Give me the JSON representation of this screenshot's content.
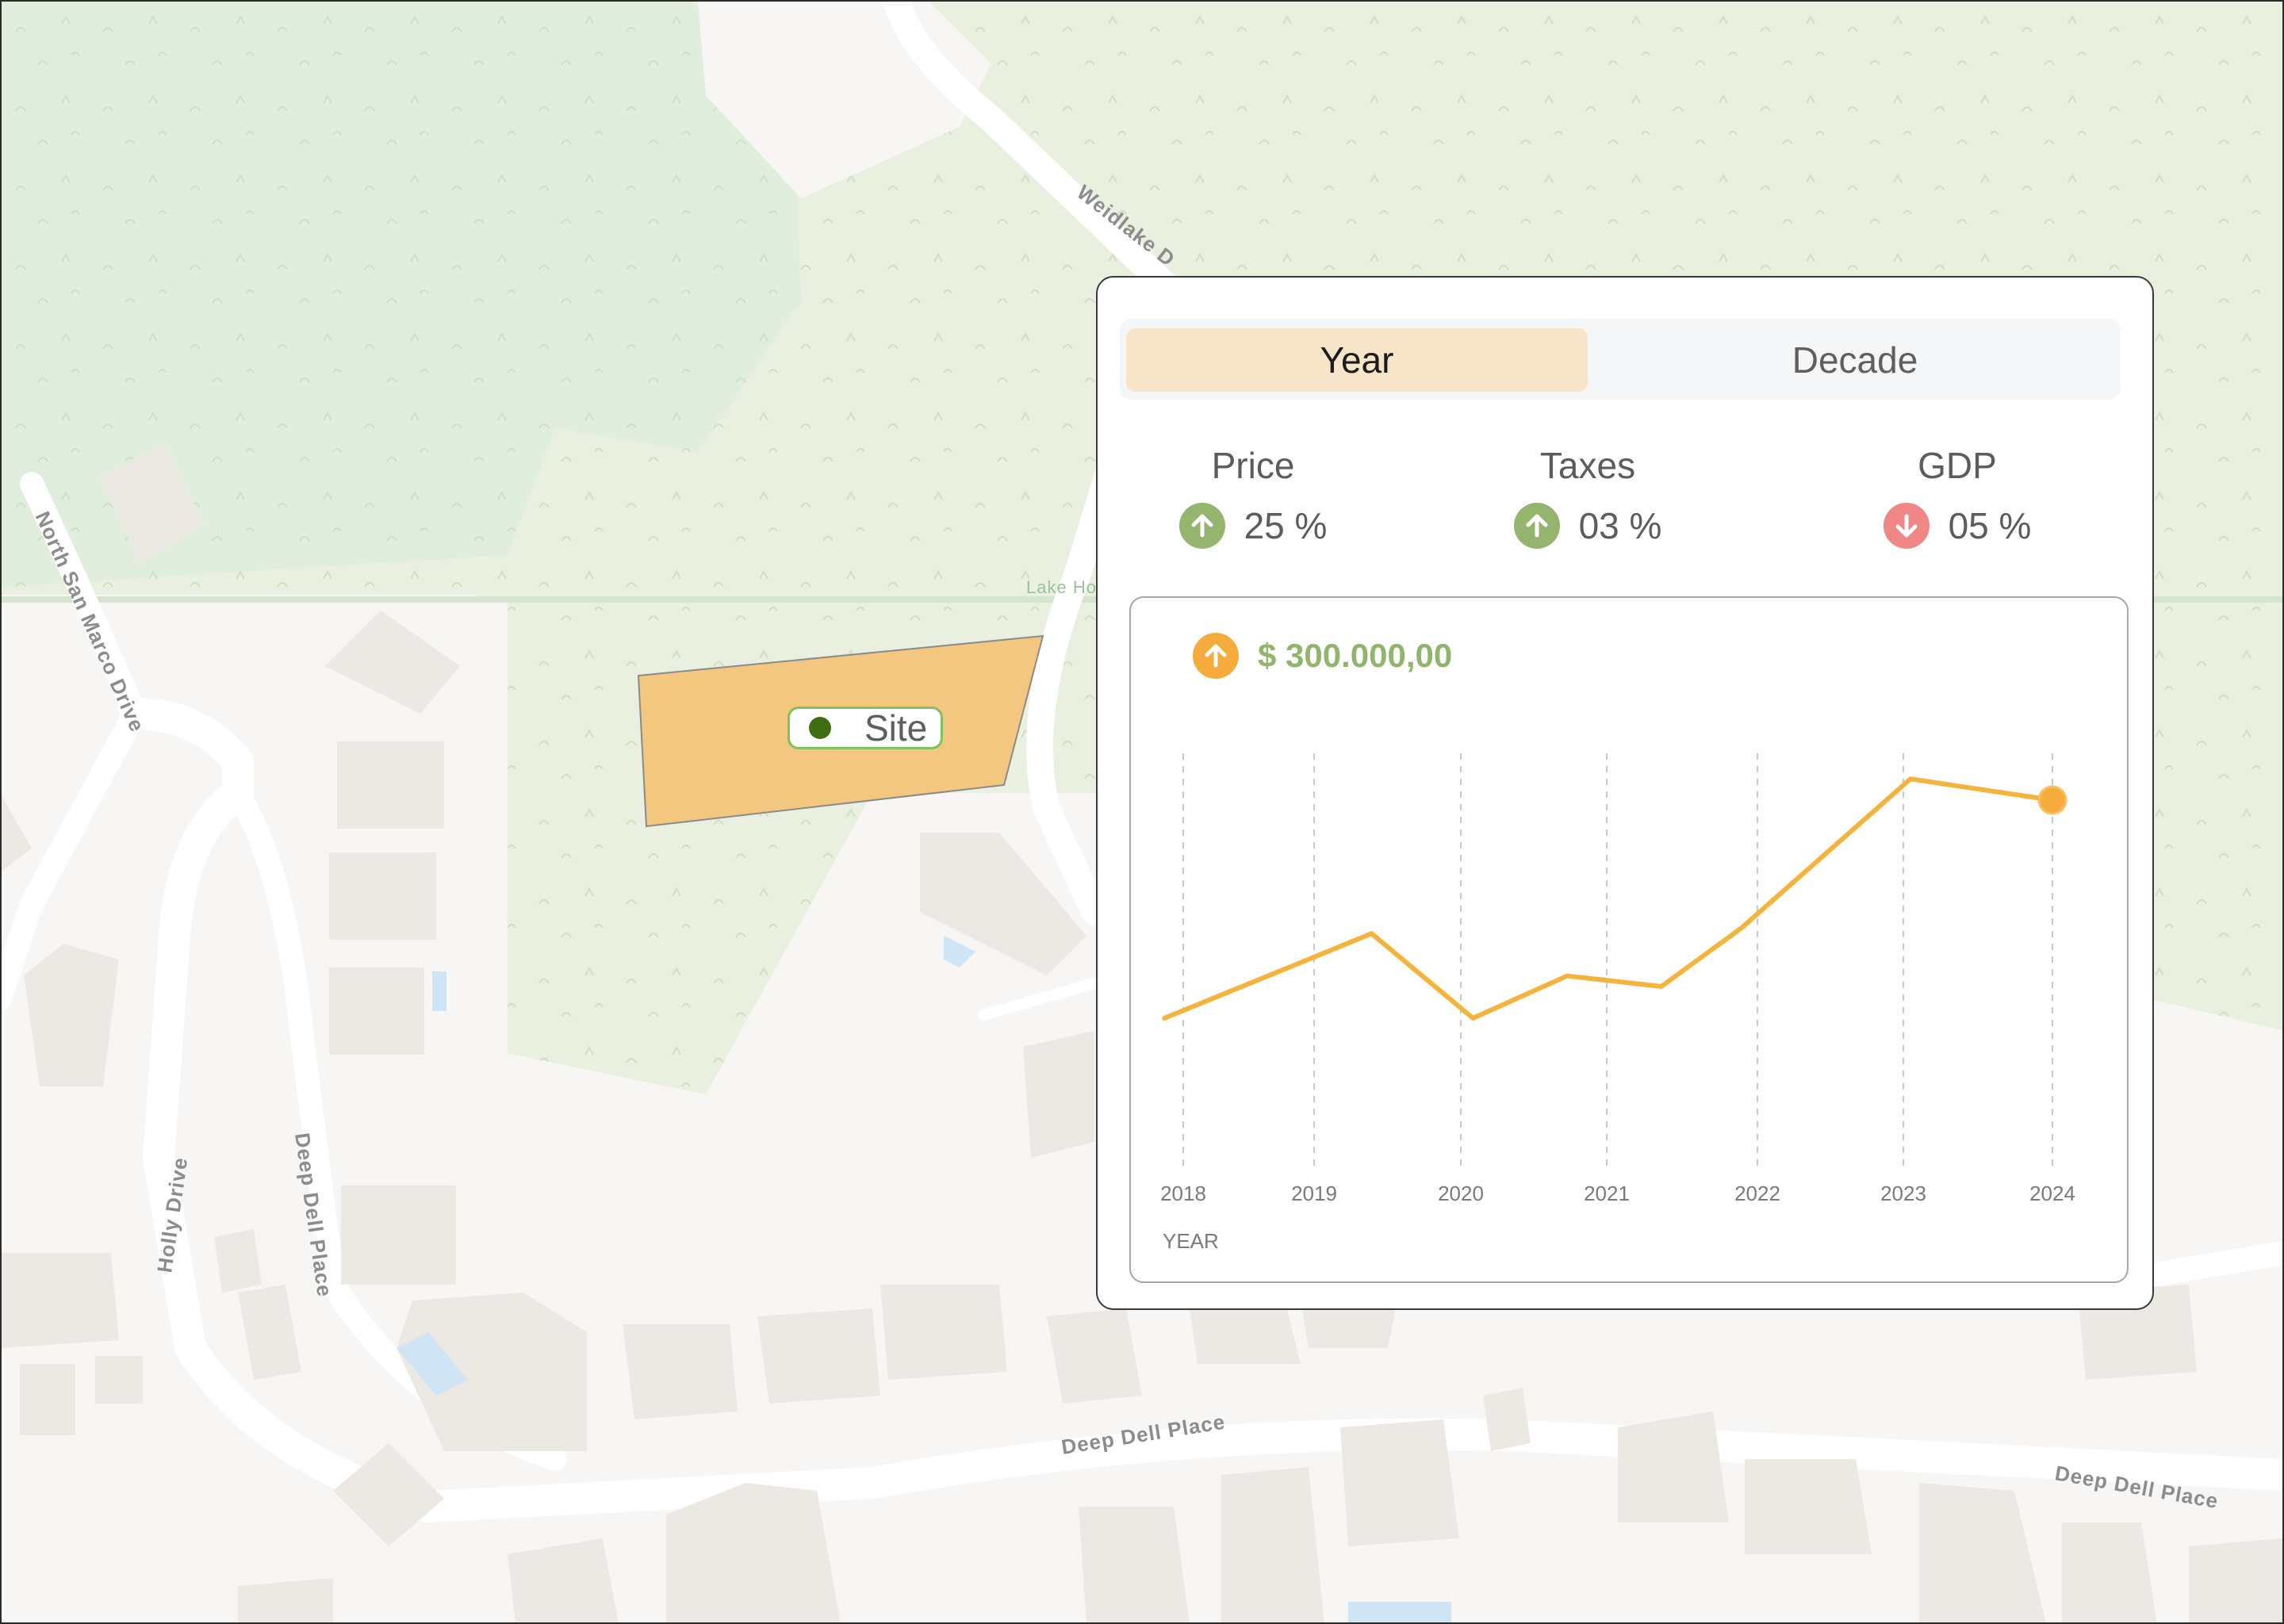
{
  "map": {
    "road_labels": [
      "Weidlake D",
      "North San Marco Drive",
      "Lake Ho",
      "Holly Drive",
      "Deep Dell Place",
      "Deep Dell Place",
      "Deep Dell Place"
    ],
    "site_label": "Site",
    "colors": {
      "forest": "#e1eede",
      "park": "#eaf0df",
      "building": "#ece8e4",
      "parcel": "#f3c77f",
      "pin_border": "#7cc25e",
      "pin_dot": "#3f6e12"
    }
  },
  "panel": {
    "tabs": [
      {
        "label": "Year",
        "active": true
      },
      {
        "label": "Decade",
        "active": false
      }
    ],
    "stats": [
      {
        "label": "Price",
        "value": "25 %",
        "trend": "up",
        "icon": "arrow-up-icon",
        "color": "#95b46e"
      },
      {
        "label": "Taxes",
        "value": "03 %",
        "trend": "up",
        "icon": "arrow-up-icon",
        "color": "#95b46e"
      },
      {
        "label": "GDP",
        "value": "05 %",
        "trend": "down",
        "icon": "arrow-down-icon",
        "color": "#f08686"
      }
    ],
    "price": {
      "value": "$ 300.000,00",
      "icon": "arrow-up-icon",
      "icon_color": "#f6ac3c"
    }
  },
  "chart_data": {
    "type": "line",
    "x": [
      2017.87,
      2019.3,
      2020.0,
      2020.65,
      2021.3,
      2021.85,
      2023.02,
      2024.0
    ],
    "values": [
      0.42,
      1.06,
      0.42,
      0.74,
      0.66,
      1.1,
      2.23,
      2.07
    ],
    "categories": [
      "2018",
      "2019",
      "2020",
      "2021",
      "2022",
      "2023",
      "2024"
    ],
    "xlabel": "YEAR",
    "ylabel": "",
    "ylim": [
      0,
      3
    ],
    "grid": "vertical dashed",
    "line_color": "#f6b33c",
    "highlight_point": {
      "x": 2024,
      "value": 2.07
    }
  }
}
